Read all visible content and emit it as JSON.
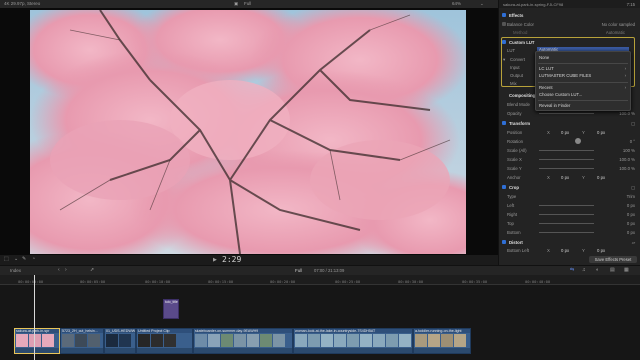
{
  "topbar": {
    "format": "4K 29.97p, Stereo",
    "zoom": "Full",
    "zoom_pct": "64%",
    "clip_name": "sakura-at-park-in-spring-FJLCF98",
    "duration": "7:15"
  },
  "viewer": {
    "timecode": "2:29"
  },
  "inspector": {
    "effects": "Effects",
    "balance_color": "Balance Color",
    "balance_value": "No color sampled",
    "method_label": "Method",
    "method_value": "Automatic",
    "custom_lut": "Custom LUT",
    "lut_label": "LUT",
    "lut_value": "Automatic",
    "convert_label": "Convert",
    "input_label": "Input",
    "output_label": "Output",
    "mix_label": "Mix",
    "compositing": "Compositing",
    "blend_mode": "Blend Mode",
    "opacity": "Opacity",
    "opacity_value": "100.0 %",
    "transform": "Transform",
    "position": "Position",
    "pos_x": "0 px",
    "pos_y": "0 px",
    "x_label": "X",
    "y_label": "Y",
    "rotation": "Rotation",
    "rotation_value": "0 °",
    "scale_all": "Scale (All)",
    "scale_all_value": "100 %",
    "scale_x": "Scale X",
    "scale_x_value": "100.0 %",
    "scale_y": "Scale Y",
    "scale_y_value": "100.0 %",
    "anchor": "Anchor",
    "anchor_x": "0 px",
    "anchor_y": "0 px",
    "crop": "Crop",
    "type": "Type",
    "type_value": "Trim",
    "left": "Left",
    "left_value": "0 px",
    "right": "Right",
    "right_value": "0 px",
    "top": "Top",
    "top_value": "0 px",
    "bottom": "Bottom",
    "bottom_value": "0 px",
    "distort": "Distort",
    "bottom_left": "Bottom Left",
    "bl_x": "0 px",
    "bl_y": "0 px",
    "save_preset": "Save Effects Preset"
  },
  "lut_menu": {
    "items": [
      "None",
      "LC LUT",
      "LUTMASTER CUBE FILES",
      "Recent",
      "Choose Custom LUT...",
      "Reveal in Finder"
    ]
  },
  "timeline": {
    "index": "Index",
    "zoom": "Full",
    "timecode": "07:00 / 21:13:09",
    "ticks": [
      "00:00:00:00",
      "00:00:05:00",
      "00:00:10:00",
      "00:00:15:00",
      "00:00:20:00",
      "00:00:25:00",
      "00:00:30:00",
      "00:00:35:00",
      "00:00:40:00"
    ],
    "title_clip": "tuto_title",
    "clips": [
      "sakura-at-park-in-spr",
      "5723_2H_cut_helsin...",
      "01_UDS-HEDWWSE",
      "Untitled Project Clip",
      "skateboarder-on-summer-day-9EAWH9",
      "woman-look-at-the-lake-in-countryside-7S4DH5AT",
      "a-toddler-running-on-the-light"
    ]
  }
}
